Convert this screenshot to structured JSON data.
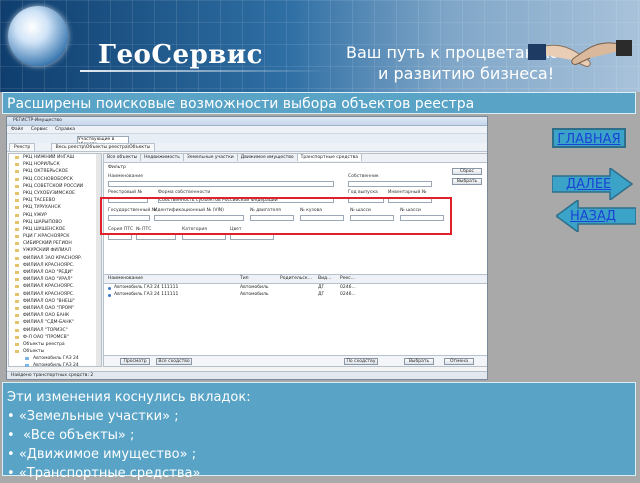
{
  "header": {
    "brand": "ГеоСервис",
    "slogan_line1": "Ваш путь к процветанию",
    "slogan_line2": "и развитию бизнеса!"
  },
  "banner": {
    "title": "Расширены поисковые возможности выбора объектов реестра"
  },
  "app": {
    "window_title": "РЕГИСТР-Имущество",
    "menu": [
      "Файл",
      "Сервис",
      "Справка"
    ],
    "toolbar_combo": "Участвующие в обороте",
    "left_tab": "Реестр",
    "path": "Весь реестр\\Объекты реестра\\Объекты",
    "tree_items": [
      "РКЦ НИЖНИЙ ИНГАШ",
      "РКЦ НОРИЛЬСК",
      "РКЦ ОКТЯБРЬСКОЕ",
      "РКЦ СОСНОВОБОРСК",
      "РКЦ СОВЕТСКОЙ РОССИИ",
      "РКЦ СУХОБУЗИМСКОЕ",
      "РКЦ ТАСЕЕВО",
      "РКЦ ТУРУХАНСК",
      "РКЦ УЖУР",
      "РКЦ ШАРЫПОВО",
      "РКЦ ШУШЕНСКОЕ",
      "РЦИ Г.КРАСНОЯРСК",
      "СИБИРСКИЙ РЕГИОН",
      "УЖУРСКИЙ ФИЛИАЛ",
      "ФИЛИАЛ ЗАО КРАСНОЯР.",
      "ФИЛИАЛ КРАСНОЯРС.",
      "ФИЛИАЛ ОАО \"РЕДИ\"",
      "ФИЛИАЛ ОАО \"УРАЛ\"",
      "ФИЛИАЛ КРАСНОЯРС.",
      "ФИЛИАЛ КРАСНОЯРС.",
      "ФИЛИАЛ ОАО \"ВНЕШ\"",
      "ФИЛИАЛ ОАО \"ПРОМ\"",
      "ФИЛИАЛ ОАО БАНК",
      "ФИЛИАЛ \"СДМ-БАНК\"",
      "ФИЛИАЛ \"ТОРИЭС\"",
      "Ф-Л ОАО \"ПРОМСВ\""
    ],
    "tree_registry": "Объекты реестра",
    "tree_objects": "Объекты",
    "tree_sub": [
      "Автомобиль ГАЗ 24",
      "Автомобиль ГАЗ 24"
    ],
    "tabs": [
      "Все объекты",
      "Недвижимость",
      "Земельные участки",
      "Движимое имущество",
      "Транспортные средства"
    ],
    "active_tab": "Транспортные средства",
    "filter": {
      "title": "Фильтр",
      "name_label": "Наименование",
      "owner_label": "Собственник",
      "reset_button": "Сброс",
      "select_button": "Выбрать",
      "reg_no_label": "Реестровый №",
      "ownership_label": "Форма собственности",
      "ownership_value": "Собственность субъектов Российской Федерации",
      "issue_label": "Год выпуска",
      "inventory_label": "Инвентарный №",
      "gos_no_label": "Государственный №",
      "vin_label": "Идентификационный № (VIN)",
      "engine_label": "№ двигателя",
      "body_label": "№ кузова",
      "chassis_label": "№ шасси",
      "frame_label": "№ шасси",
      "pts_series_label": "Серия ПТС",
      "pts_no_label": "№ ПТС",
      "category_label": "Категория",
      "color_label": "Цвет"
    },
    "grid": {
      "headers": [
        "Наименование",
        "Тип",
        "Родительск...",
        "Вид...",
        "Реес..."
      ],
      "rows": [
        [
          "Автомобиль ГАЗ 24 111111",
          "Автомобиль",
          "",
          "ДГ",
          "0246..."
        ],
        [
          "Автомобиль ГАЗ 24 111111",
          "Автомобиль",
          "",
          "ДГ",
          "0246..."
        ]
      ]
    },
    "bottom_buttons": [
      "Просмотр",
      "Все сходство",
      "По сходству",
      "Выбрать",
      "Отмена"
    ],
    "status": "Найдено транспортных средств: 2"
  },
  "nav": {
    "main": "ГЛАВНАЯ",
    "next": "ДАЛЕЕ",
    "back": "НАЗАД"
  },
  "bottom_panel": {
    "intro": "Эти изменения коснулись вкладок:",
    "items": [
      "«Земельные участки» ;",
      "«Все объекты» ;",
      "«Движимое имущество» ;",
      "«Транспортные средства»"
    ]
  },
  "colors": {
    "panel": "#58a3c6",
    "link": "#1a44d6",
    "highlight": "#e0202a",
    "arrow": "#3ba3c7"
  }
}
